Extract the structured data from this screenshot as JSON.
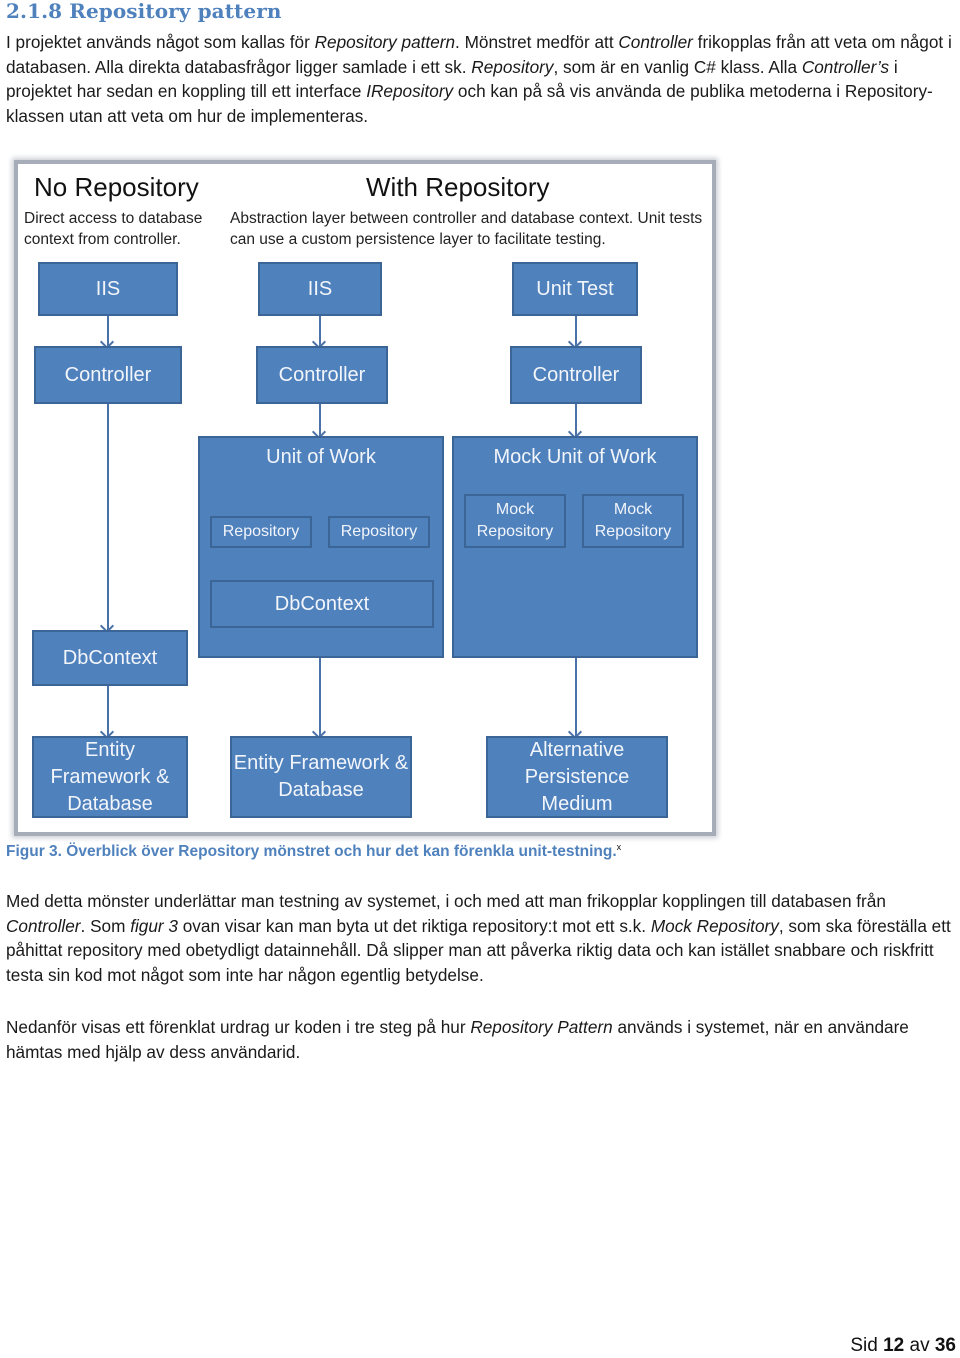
{
  "heading": "2.1.8 Repository pattern",
  "paragraph1": {
    "parts": [
      {
        "t": "I projektet används något som kallas för ",
        "i": false
      },
      {
        "t": "Repository pattern",
        "i": true
      },
      {
        "t": ". Mönstret medför att ",
        "i": false
      },
      {
        "t": "Controller",
        "i": true
      },
      {
        "t": " frikopplas från att veta om något i databasen. Alla direkta databasfrågor ligger samlade i ett sk. ",
        "i": false
      },
      {
        "t": "Repository",
        "i": true
      },
      {
        "t": ", som är en vanlig C# klass. Alla ",
        "i": false
      },
      {
        "t": "Controller’s",
        "i": true
      },
      {
        "t": " i projektet har sedan en koppling till ett interface ",
        "i": false
      },
      {
        "t": "IRepository",
        "i": true
      },
      {
        "t": " och kan på så vis använda de publika metoderna i Repository-klassen utan att veta om hur de implementeras.",
        "i": false
      }
    ]
  },
  "figure": {
    "no_repo": {
      "title": "No Repository",
      "subtitle": "Direct access to database context from controller.",
      "boxes": {
        "iis": "IIS",
        "controller": "Controller",
        "dbcontext": "DbContext",
        "ef": "Entity Framework & Database"
      }
    },
    "with_repo": {
      "title": "With Repository",
      "subtitle": "Abstraction layer between controller and database context. Unit tests can use a custom persistence layer to facilitate testing.",
      "left": {
        "iis": "IIS",
        "controller": "Controller",
        "unit_of_work": "Unit of Work",
        "repo1": "Repository",
        "repo2": "Repository",
        "dbcontext": "DbContext",
        "ef": "Entity Framework & Database"
      },
      "right": {
        "unit_test": "Unit Test",
        "controller": "Controller",
        "mock_unit_of_work": "Mock Unit of Work",
        "mock_repo1": "Mock Repository",
        "mock_repo2": "Mock Repository",
        "alt": "Alternative Persistence Medium"
      }
    },
    "colors": {
      "box_fill": "#4f81bd",
      "box_border": "#3a6596",
      "box_text": "#f2f5fa",
      "frame": "#a6adb8"
    }
  },
  "caption": {
    "text": "Figur 3. Överblick över Repository mönstret och hur det kan förenkla unit-testning",
    "period": ".",
    "footnote": "x"
  },
  "paragraph2": {
    "parts": [
      {
        "t": "Med detta mönster underlättar man testning av systemet, i och med att man frikopplar kopplingen till databasen från ",
        "i": false
      },
      {
        "t": "Controller",
        "i": true
      },
      {
        "t": ". Som ",
        "i": false
      },
      {
        "t": "figur 3",
        "i": true
      },
      {
        "t": " ovan visar kan man byta ut det riktiga repository:t mot ett s.k. ",
        "i": false
      },
      {
        "t": "Mock Repository",
        "i": true
      },
      {
        "t": ", som ska föreställa ett påhittat repository med obetydligt datainnehåll. Då slipper man att påverka riktig data och kan istället snabbare och riskfritt testa sin kod mot något som inte har någon egentlig betydelse.",
        "i": false
      }
    ]
  },
  "paragraph3": {
    "parts": [
      {
        "t": "Nedanför visas ett förenklat urdrag ur koden i tre steg på hur ",
        "i": false
      },
      {
        "t": "Repository Pattern",
        "i": true
      },
      {
        "t": " används i systemet, när en användare hämtas med hjälp av dess användarid.",
        "i": false
      }
    ]
  },
  "footer": {
    "prefix": "Sid",
    "page": "12",
    "sep": "av",
    "total": "36"
  },
  "accent_color": "#4f81bd"
}
